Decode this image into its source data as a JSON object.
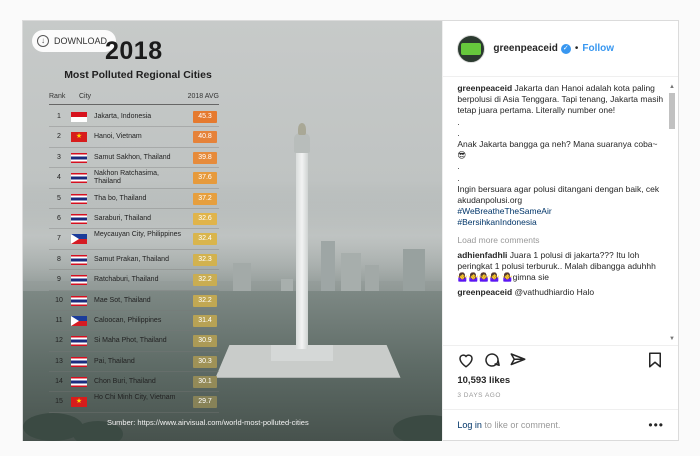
{
  "photo": {
    "download_label": "DOWNLOAD",
    "infographic": {
      "year": "2018",
      "title": "Most Polluted Regional Cities",
      "col_rank": "Rank",
      "col_city": "City",
      "col_avg": "2018 AVG",
      "rows": [
        {
          "rank": "1",
          "city": "Jakarta, Indonesia",
          "flag": "id",
          "value": "45.3",
          "color": "#e57a2f"
        },
        {
          "rank": "2",
          "city": "Hanoi, Vietnam",
          "flag": "vn",
          "value": "40.8",
          "color": "#e5823a"
        },
        {
          "rank": "3",
          "city": "Samut Sakhon, Thailand",
          "flag": "th",
          "value": "39.8",
          "color": "#e68b3b"
        },
        {
          "rank": "4",
          "city": "Nakhon Ratchasima, Thailand",
          "flag": "th",
          "value": "37.6",
          "color": "#e69a3c"
        },
        {
          "rank": "5",
          "city": "Tha bo, Thailand",
          "flag": "th",
          "value": "37.2",
          "color": "#e69f3e"
        },
        {
          "rank": "6",
          "city": "Saraburi, Thailand",
          "flag": "th",
          "value": "32.6",
          "color": "#e0b44b"
        },
        {
          "rank": "7",
          "city": "Meycauyan City, Philippines",
          "flag": "ph",
          "value": "32.4",
          "color": "#d9b54d"
        },
        {
          "rank": "8",
          "city": "Samut Prakan, Thailand",
          "flag": "th",
          "value": "32.3",
          "color": "#d2b24f"
        },
        {
          "rank": "9",
          "city": "Ratchaburi, Thailand",
          "flag": "th",
          "value": "32.2",
          "color": "#c9ad52"
        },
        {
          "rank": "10",
          "city": "Mae Sot, Thailand",
          "flag": "th",
          "value": "32.2",
          "color": "#c1a853"
        },
        {
          "rank": "11",
          "city": "Caloocan, Philippines",
          "flag": "ph",
          "value": "31.4",
          "color": "#b7a255"
        },
        {
          "rank": "12",
          "city": "Si Maha Phot, Thailand",
          "flag": "th",
          "value": "30.9",
          "color": "#ab9a56"
        },
        {
          "rank": "13",
          "city": "Pai, Thailand",
          "flag": "th",
          "value": "30.3",
          "color": "#9f9257"
        },
        {
          "rank": "14",
          "city": "Chon Buri, Thailand",
          "flag": "th",
          "value": "30.1",
          "color": "#938a58"
        },
        {
          "rank": "15",
          "city": "Ho Chi Minh City, Vietnam",
          "flag": "vn",
          "value": "29.7",
          "color": "#878258"
        }
      ],
      "source": "Sumber: https://www.airvisual.com/world-most-polluted-cities"
    }
  },
  "header": {
    "username": "greenpeaceid",
    "separator": "•",
    "follow_label": "Follow"
  },
  "caption": {
    "username": "greenpeaceid",
    "line1": "Jakarta dan Hanoi adalah kota paling berpolusi di Asia Tenggara. Tapi tenang, Jakarta masih tetap juara pertama. Literally number one!",
    "dot1": ".",
    "dot2": ".",
    "line2": "Anak Jakarta bangga ga neh? Mana suaranya coba~ 😎",
    "dot3": ".",
    "dot4": ".",
    "line3": "Ingin bersuara agar polusi ditangani dengan baik, cek akudanpolusi.org",
    "hashtag1": "#WeBreatheTheSameAir",
    "hashtag2": "#BersihkanIndonesia"
  },
  "comments": {
    "load_more": "Load more comments",
    "items": [
      {
        "username": "adhienfadhli",
        "text": "Juara 1 polusi di jakarta??? Itu loh peringkat 1 polusi terburuk.. Malah dibangga aduhhh 🤷‍♀️🤷‍♀️🤷‍♀️🤷‍♀️ 🤷‍♀️gimna sie"
      },
      {
        "username": "greenpeaceid",
        "text": "@vathudhiardio Halo"
      }
    ]
  },
  "actions": {
    "likes": "10,593 likes",
    "time_ago": "3 DAYS AGO",
    "login_link": "Log in",
    "login_text": " to like or comment.",
    "more": "•••"
  }
}
